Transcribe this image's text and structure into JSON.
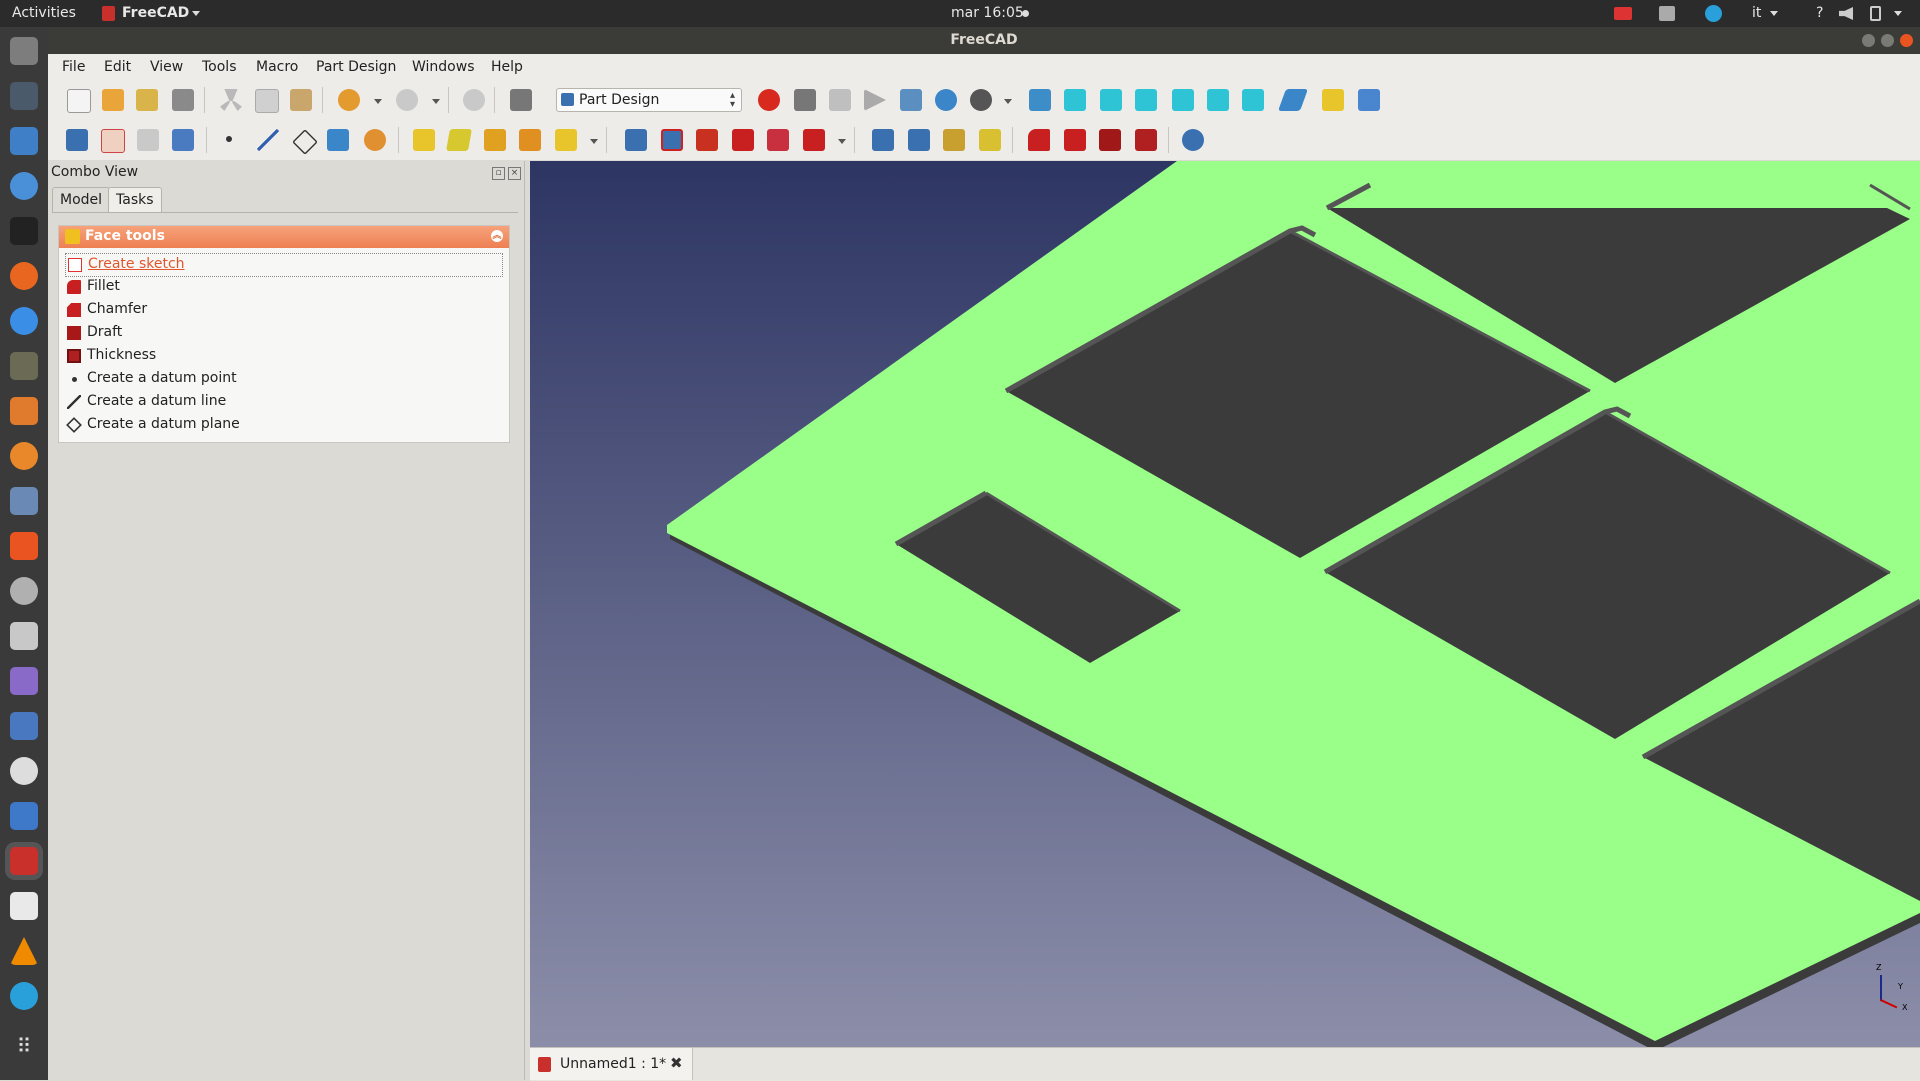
{
  "topbar": {
    "activities": "Activities",
    "app_name": "FreeCAD",
    "clock": "mar 16:05",
    "language": "it",
    "help": "?"
  },
  "window": {
    "title": "FreeCAD"
  },
  "menu": [
    "File",
    "Edit",
    "View",
    "Tools",
    "Macro",
    "Part Design",
    "Windows",
    "Help"
  ],
  "toolbar": {
    "workbench": "Part Design"
  },
  "combo_view": {
    "title": "Combo View",
    "tabs": [
      "Model",
      "Tasks"
    ],
    "active_tab": "Tasks"
  },
  "task_panel": {
    "header": "Face tools",
    "items": [
      {
        "label": "Create sketch",
        "icon": "sketch-icon"
      },
      {
        "label": "Fillet",
        "icon": "fillet-icon"
      },
      {
        "label": "Chamfer",
        "icon": "chamfer-icon"
      },
      {
        "label": "Draft",
        "icon": "draft-icon"
      },
      {
        "label": "Thickness",
        "icon": "thickness-icon"
      },
      {
        "label": "Create a datum point",
        "icon": "datum-point-icon"
      },
      {
        "label": "Create a datum line",
        "icon": "datum-line-icon"
      },
      {
        "label": "Create a datum plane",
        "icon": "datum-plane-icon"
      }
    ]
  },
  "document_tab": {
    "label": "Unnamed1 : 1*"
  },
  "axis": {
    "z": "Z",
    "y": "Y",
    "x": "X"
  },
  "colors": {
    "model_face": "#99ff88",
    "model_edge": "#555555",
    "accent": "#ee8052"
  }
}
